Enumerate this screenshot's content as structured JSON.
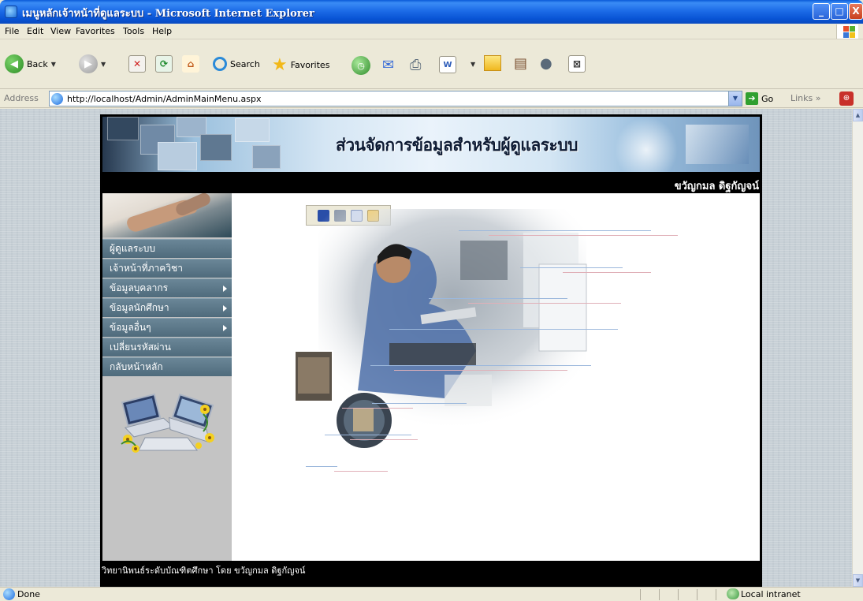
{
  "window": {
    "title": "เมนูหลักเจ้าหน้าที่ดูแลระบบ - Microsoft Internet Explorer",
    "controls": {
      "minimize": "_",
      "maximize": "□",
      "close": "X"
    }
  },
  "menubar": {
    "items": [
      "File",
      "Edit",
      "View",
      "Favorites",
      "Tools",
      "Help"
    ]
  },
  "toolbar": {
    "back_label": "Back",
    "search_label": "Search",
    "favorites_label": "Favorites",
    "icons": [
      "back-icon",
      "forward-icon",
      "stop-icon",
      "refresh-icon",
      "home-icon",
      "search-icon",
      "favorites-star-icon",
      "history-icon",
      "mail-icon",
      "print-icon",
      "word-icon",
      "folder-icon",
      "research-icon",
      "messenger-icon",
      "bookmark-icon"
    ]
  },
  "address": {
    "label": "Address",
    "url": "http://localhost/Admin/AdminMainMenu.aspx",
    "go_label": "Go",
    "links_label": "Links"
  },
  "page": {
    "banner_title": "ส่วนจัดการข้อมูลสำหรับผู้ดูแลระบบ",
    "user_name": "ขวัญกมล ดิฐกัญจน์",
    "menu": [
      {
        "label": "ผู้ดูแลระบบ",
        "submenu": false
      },
      {
        "label": "เจ้าหน้าที่ภาควิชา",
        "submenu": false
      },
      {
        "label": "ข้อมูลบุคลากร",
        "submenu": true
      },
      {
        "label": "ข้อมูลนักศึกษา",
        "submenu": true
      },
      {
        "label": "ข้อมูลอื่นๆ",
        "submenu": true
      },
      {
        "label": "เปลี่ยนรหัสผ่าน",
        "submenu": false
      },
      {
        "label": "กลับหน้าหลัก",
        "submenu": false
      }
    ],
    "footer": "วิทยานิพนธ์ระดับบัณฑิตศึกษา โดย ขวัญกมล ดิฐกัญจน์"
  },
  "statusbar": {
    "status": "Done",
    "zone": "Local intranet"
  },
  "colors": {
    "titlebar": "#0a5ad8",
    "menu_item": "#5b7585",
    "page_background": "#000000",
    "content_background": "#ffffff"
  }
}
